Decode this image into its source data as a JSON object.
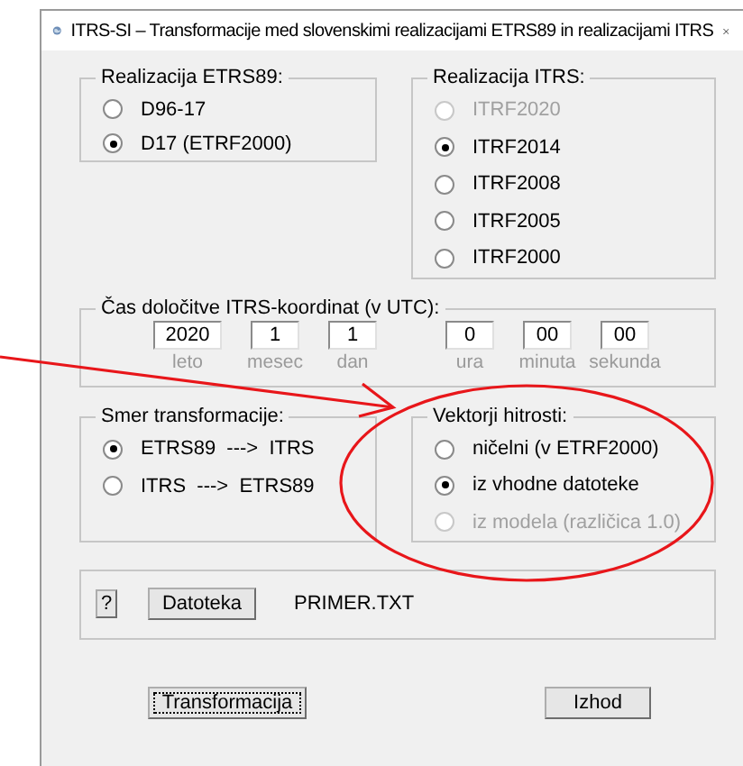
{
  "window": {
    "title": "ITRS-SI – Transformacije med slovenskimi realizacijami ETRS89 in realizacijami ITRS"
  },
  "etrs89_group": {
    "title": "Realizacija ETRS89:",
    "options": [
      {
        "label": "D96-17",
        "selected": false,
        "disabled": false
      },
      {
        "label": "D17 (ETRF2000)",
        "selected": true,
        "disabled": false
      }
    ]
  },
  "itrs_group": {
    "title": "Realizacija ITRS:",
    "options": [
      {
        "label": "ITRF2020",
        "selected": false,
        "disabled": true
      },
      {
        "label": "ITRF2014",
        "selected": true,
        "disabled": false
      },
      {
        "label": "ITRF2008",
        "selected": false,
        "disabled": false
      },
      {
        "label": "ITRF2005",
        "selected": false,
        "disabled": false
      },
      {
        "label": "ITRF2000",
        "selected": false,
        "disabled": false
      }
    ]
  },
  "time_group": {
    "title": "Čas določitve ITRS-koordinat (v UTC):",
    "fields": [
      {
        "value": "2020",
        "label": "leto"
      },
      {
        "value": "1",
        "label": "mesec"
      },
      {
        "value": "1",
        "label": "dan"
      },
      {
        "value": "0",
        "label": "ura"
      },
      {
        "value": "00",
        "label": "minuta"
      },
      {
        "value": "00",
        "label": "sekunda"
      }
    ]
  },
  "direction_group": {
    "title": "Smer transformacije:",
    "options": [
      {
        "label": "ETRS89  --->  ITRS",
        "selected": true,
        "disabled": false
      },
      {
        "label": "ITRS  --->  ETRS89",
        "selected": false,
        "disabled": false
      }
    ]
  },
  "velocity_group": {
    "title": "Vektorji hitrosti:",
    "options": [
      {
        "label": "ničelni (v ETRF2000)",
        "selected": false,
        "disabled": false
      },
      {
        "label": "iz vhodne datoteke",
        "selected": true,
        "disabled": false
      },
      {
        "label": "iz modela (različica 1.0)",
        "selected": false,
        "disabled": true
      }
    ]
  },
  "file_panel": {
    "help_button": "?",
    "file_button": "Datoteka",
    "file_name": "PRIMER.TXT"
  },
  "buttons": [
    {
      "label": "Transformacija",
      "focused": true
    },
    {
      "label": "Izhod",
      "focused": false
    }
  ]
}
